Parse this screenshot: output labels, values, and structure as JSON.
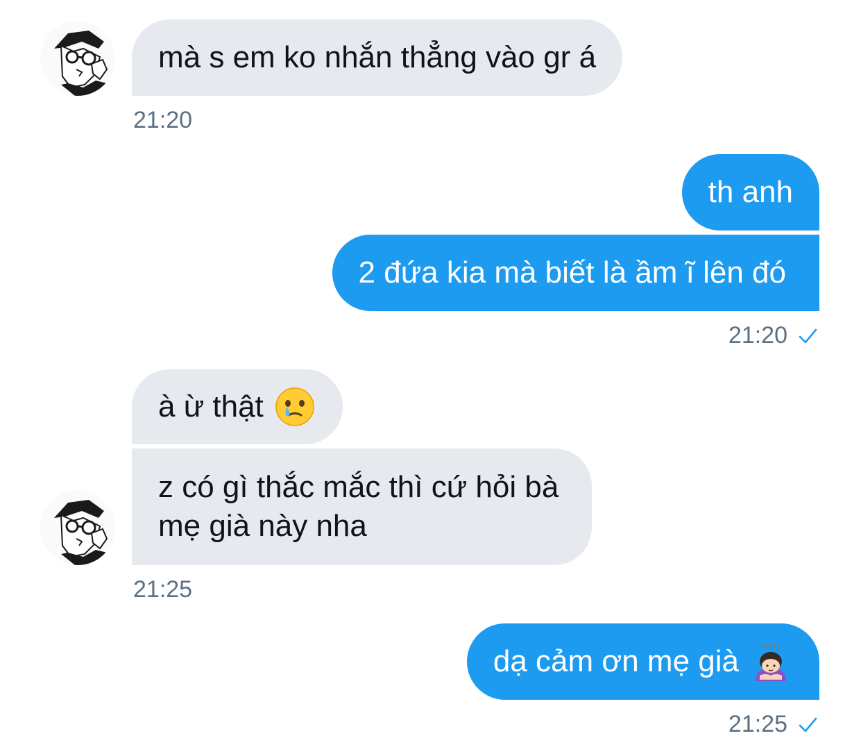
{
  "messages": [
    {
      "id": "m1",
      "direction": "received",
      "text": "mà s em ko nhắn thẳng vào gr á",
      "time": "21:20"
    },
    {
      "id": "m2",
      "direction": "sent",
      "text": "th anh"
    },
    {
      "id": "m3",
      "direction": "sent",
      "text": "2 đứa kia mà biết là ầm ĩ lên đó",
      "time": "21:20"
    },
    {
      "id": "m4",
      "direction": "received",
      "text": "à ừ thật",
      "emoji": "face-holding-back-tears-icon"
    },
    {
      "id": "m5",
      "direction": "received",
      "line1": "z có gì thắc mắc thì cứ hỏi bà",
      "line2": "mẹ già này nha",
      "time": "21:25"
    },
    {
      "id": "m6",
      "direction": "sent",
      "text": "dạ cảm ơn mẹ già",
      "emoji": "person-bowing-icon",
      "time": "21:25"
    }
  ],
  "icons": {
    "read_receipt": "check-icon",
    "avatar": "manga-avatar-icon"
  },
  "colors": {
    "sent_bubble": "#1d9bf0",
    "received_bubble": "#e6e9ee",
    "timestamp": "#5b7083",
    "check": "#1d9bf0"
  }
}
